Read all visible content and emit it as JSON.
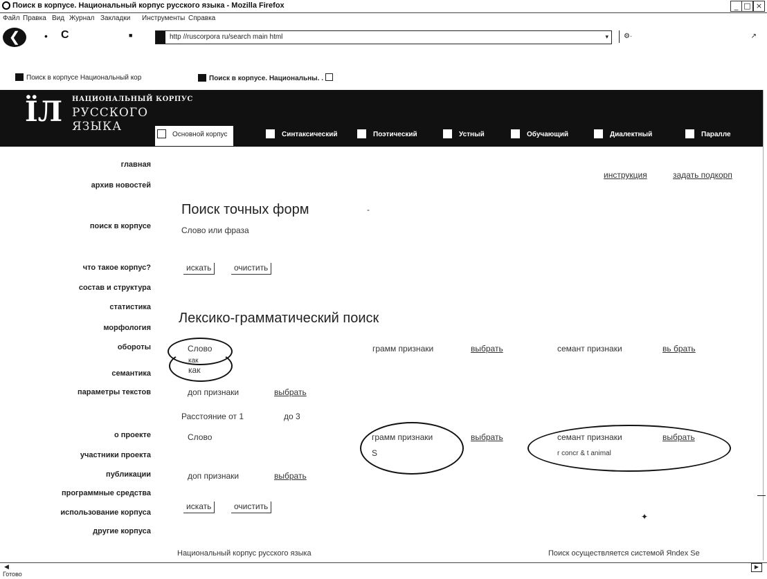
{
  "window": {
    "title": "Поиск в корпусе. Национальный корпус русского языка - Mozilla Firefox",
    "controls": [
      "_",
      "□",
      "×"
    ]
  },
  "menu": [
    "Файл",
    "Правка",
    "Вид",
    "Журнал",
    "Закладки",
    "Инструменты",
    "Справка"
  ],
  "navbar": {
    "reload": "C",
    "url": "http //ruscorpora ru/search main html",
    "search_value": ""
  },
  "bookmarks": [
    "Поиск в корпусе Национальный кор",
    "Поиск в корпусе. Национальны. ."
  ],
  "site": {
    "logo_line1": "НАЦИОНАЛЬНЫЙ КОРПУС",
    "logo_line2": "РУССКОГО",
    "logo_line3": "ЯЗЫКА",
    "tabs": [
      "Основной корпус",
      "Синтаксический",
      "Поэтический",
      "Устный",
      "Обучающий",
      "Диалектный",
      "Паралле"
    ]
  },
  "left_nav": [
    "главная",
    "архив новостей",
    "поиск в корпусе",
    "что такое корпус?",
    "состав и структура",
    "статистика",
    "морфология",
    "обороты",
    "семантика",
    "параметры текстов",
    "о проекте",
    "участники проекта",
    "публикации",
    "программные средства",
    "использование корпуса",
    "другие корпуса"
  ],
  "top_links": {
    "instruction": "инструкция",
    "subcorpus": "задать подкорп"
  },
  "exact_search": {
    "heading": "Поиск точных форм",
    "field_label": "Слово или фраза",
    "search_btn": "искать",
    "clear_btn": "очистить"
  },
  "lexgram": {
    "heading": "Лексико-грамматический поиск",
    "word1_label": "Слово",
    "word1_value": "как",
    "gram_label": "грамм признаки",
    "sem_label": "семант признаки",
    "choose": "выбрать",
    "choose_sem1": "вь брать",
    "extra_label": "доп признаки",
    "distance_label": "Расстояние от 1",
    "distance_to": "до 3",
    "word2_label": "Слово",
    "gram2_value": "S",
    "sem2_value": "r concr & t animal",
    "search_btn": "искать",
    "clear_btn": "очистить"
  },
  "footer": {
    "left": "Национальный корпус русского языка",
    "right": "Поиск осуществляется системой Яndex Se"
  },
  "status": "Готово"
}
